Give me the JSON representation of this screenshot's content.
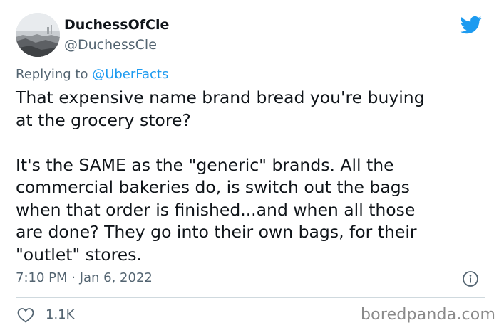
{
  "author": {
    "display_name": "DuchessOfCle",
    "handle": "@DuchessCle"
  },
  "reply": {
    "prefix": "Replying to ",
    "mention": "@UberFacts"
  },
  "tweet": {
    "text": "That expensive name brand bread you're buying\nat the grocery store?\n\nIt's the SAME as the \"generic\" brands. All the\ncommercial bakeries do, is switch out the bags\nwhen that order is finished...and when all those\nare done? They go into their own bags, for their\n\"outlet\" stores.",
    "timestamp": "7:10 PM · Jan 6, 2022"
  },
  "actions": {
    "like_count": "1.1K"
  },
  "watermark": "boredpanda.com",
  "icons": {
    "platform": "twitter-bird-icon",
    "info": "info-icon",
    "like": "heart-icon"
  },
  "colors": {
    "accent": "#1d9bf0",
    "text": "#0f1419",
    "secondary_text": "#536471",
    "divider": "#cfd9de"
  }
}
